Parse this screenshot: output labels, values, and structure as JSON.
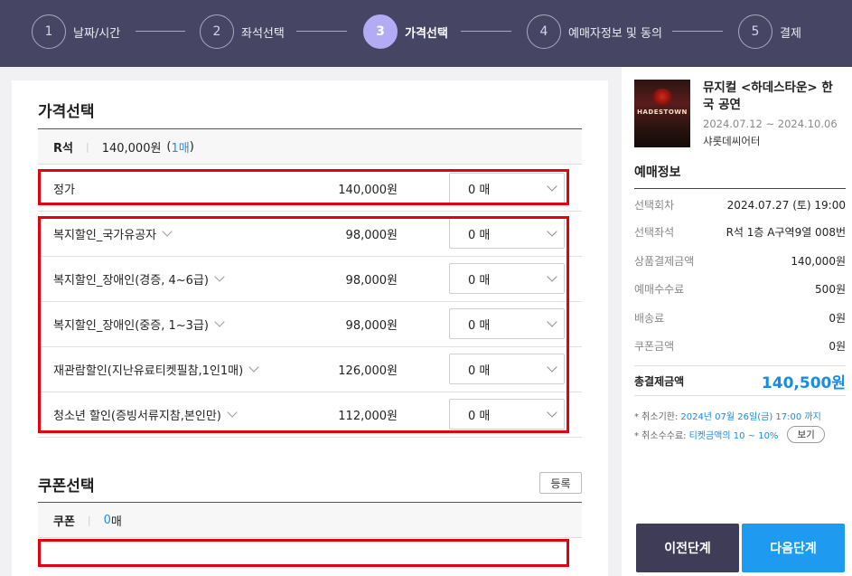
{
  "steps": [
    {
      "num": "1",
      "label": "날짜/시간"
    },
    {
      "num": "2",
      "label": "좌석선택"
    },
    {
      "num": "3",
      "label": "가격선택"
    },
    {
      "num": "4",
      "label": "예매자정보 및 동의"
    },
    {
      "num": "5",
      "label": "결제"
    }
  ],
  "price_section": {
    "title": "가격선택",
    "grade": "R석",
    "grade_price": "140,000원",
    "grade_count_open": "(",
    "grade_count": "1매",
    "grade_count_close": ")",
    "rows": [
      {
        "name": "정가",
        "price": "140,000원",
        "qty": "0 매"
      },
      {
        "name": "복지할인_국가유공자",
        "price": "98,000원",
        "qty": "0 매"
      },
      {
        "name": "복지할인_장애인(경증, 4~6급)",
        "price": "98,000원",
        "qty": "0 매"
      },
      {
        "name": "복지할인_장애인(중증, 1~3급)",
        "price": "98,000원",
        "qty": "0 매"
      },
      {
        "name": "재관람할인(지난유료티켓필참,1인1매)",
        "price": "126,000원",
        "qty": "0 매"
      },
      {
        "name": "청소년 할인(증빙서류지참,본인만)",
        "price": "112,000원",
        "qty": "0 매"
      }
    ]
  },
  "coupon_section": {
    "title": "쿠폰선택",
    "register_label": "등록",
    "coupon_label": "쿠폰",
    "coupon_count_num": "0",
    "coupon_count_unit": "매"
  },
  "sidebar": {
    "show_title": "뮤지컬 <하데스타운> 한국 공연",
    "show_dates": "2024.07.12 ~ 2024.10.06",
    "venue": "샤롯데씨어터",
    "poster_text": "HADESTOWN",
    "info_title": "예매정보",
    "info": [
      {
        "k": "선택회차",
        "v": "2024.07.27 (토) 19:00"
      },
      {
        "k": "선택좌석",
        "v": "R석 1층 A구역9열 008번"
      },
      {
        "k": "상품결제금액",
        "v": "140,000원"
      },
      {
        "k": "예매수수료",
        "v": "500원"
      },
      {
        "k": "배송료",
        "v": "0원"
      },
      {
        "k": "쿠폰금액",
        "v": "0원"
      }
    ],
    "total_label": "총결제금액",
    "total_value": "140,500원",
    "note1_label": "* 취소기한:",
    "note1_value": "2024년 07월 26일(금) 17:00 까지",
    "note2_label": "* 취소수수료:",
    "note2_value": "티켓금액의 10 ~ 10%",
    "view_label": "보기",
    "prev_label": "이전단계",
    "next_label": "다음단계"
  },
  "colors": {
    "header_bg": "#474564",
    "active_step": "#b3abf3",
    "accent_blue": "#1e9bf0",
    "highlight_red": "#e5000d"
  }
}
